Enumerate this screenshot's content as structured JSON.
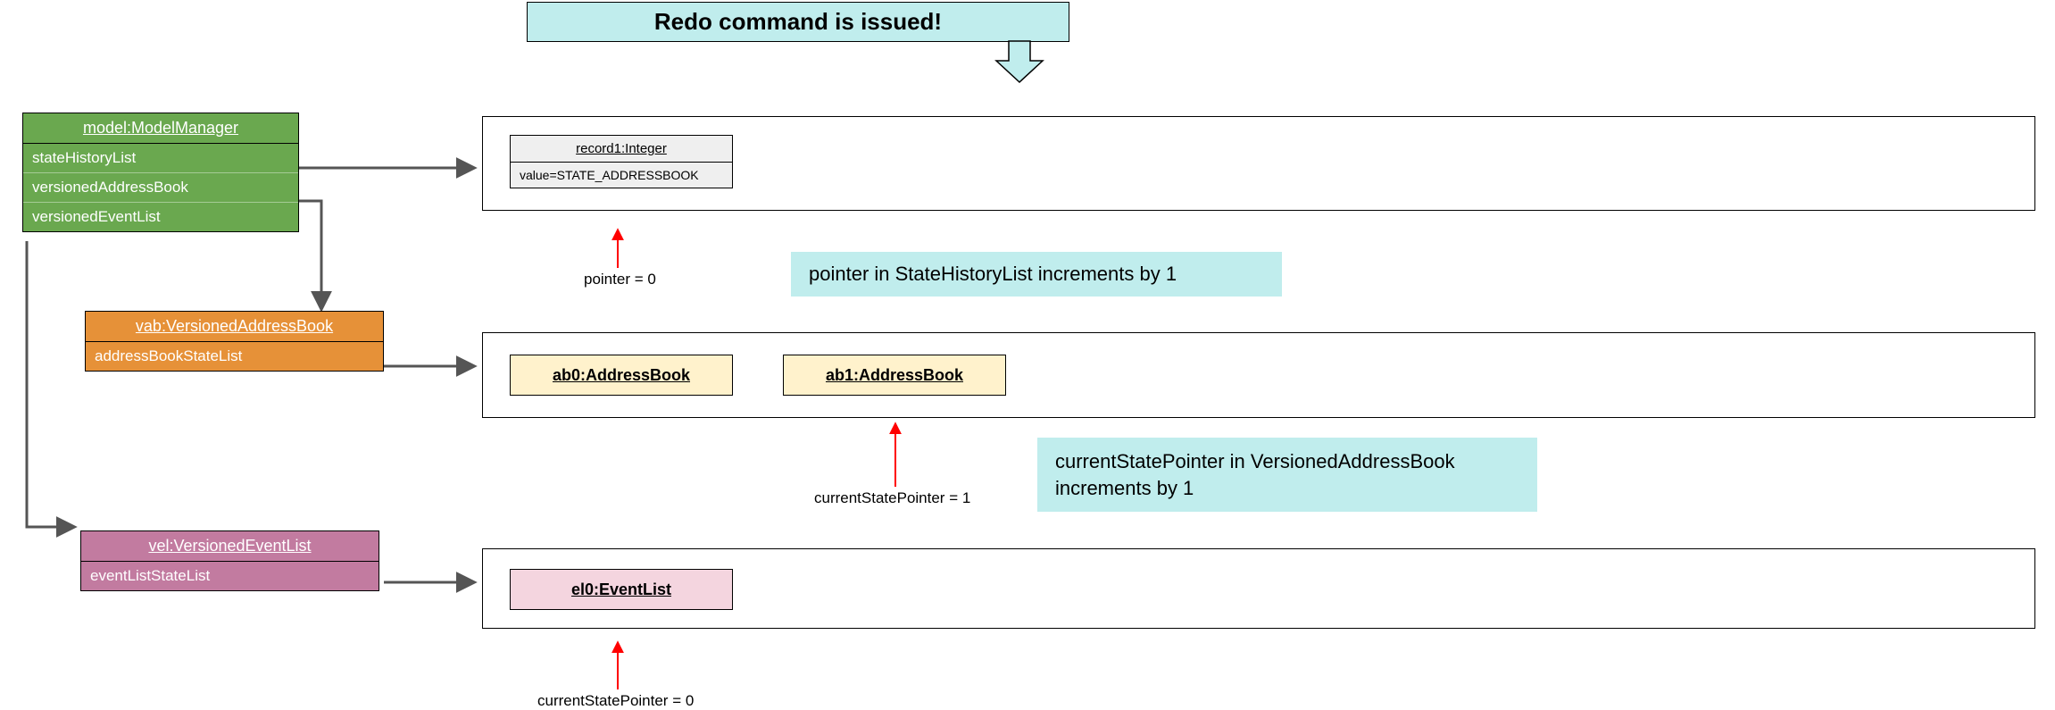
{
  "banner": {
    "title": "Redo command is issued!"
  },
  "notes": {
    "state_history": "pointer in StateHistoryList increments by 1",
    "vab": "currentStatePointer in VersionedAddressBook increments by 1"
  },
  "model": {
    "title": "model:ModelManager",
    "fields": {
      "f0": "stateHistoryList",
      "f1": "versionedAddressBook",
      "f2": "versionedEventList"
    }
  },
  "vab_box": {
    "title": "vab:VersionedAddressBook",
    "fields": {
      "f0": "addressBookStateList"
    }
  },
  "vel_box": {
    "title": "vel:VersionedEventList",
    "fields": {
      "f0": "eventListStateList"
    }
  },
  "record1": {
    "title": "record1:Integer",
    "value": "value=STATE_ADDRESSBOOK"
  },
  "ab0": "ab0:AddressBook",
  "ab1": "ab1:AddressBook",
  "el0": "el0:EventList",
  "pointer_labels": {
    "p0": "pointer = 0",
    "csp1": "currentStatePointer = 1",
    "csp0": "currentStatePointer = 0"
  }
}
